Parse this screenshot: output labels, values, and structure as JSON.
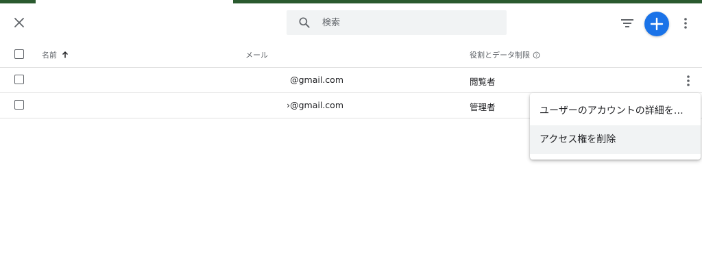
{
  "toolbar": {
    "close_icon": "close-icon",
    "search": {
      "placeholder": "検索",
      "value": ""
    },
    "filter_icon": "filter-icon",
    "add_icon": "plus-icon",
    "more_icon": "more-vert-icon",
    "accent_color": "#1a73e8",
    "top_bar_color": "#2a5a2f"
  },
  "table": {
    "columns": {
      "name": "名前",
      "email": "メール",
      "role": "役割とデータ制限"
    },
    "sort": "ascending",
    "rows": [
      {
        "name": "",
        "email": "@gmail.com",
        "role": "閲覧者"
      },
      {
        "name": "",
        "email": "›@gmail.com",
        "role": "管理者"
      }
    ]
  },
  "context_menu": {
    "items": [
      {
        "label": "ユーザーのアカウントの詳細を…"
      },
      {
        "label": "アクセス権を削除"
      }
    ]
  }
}
